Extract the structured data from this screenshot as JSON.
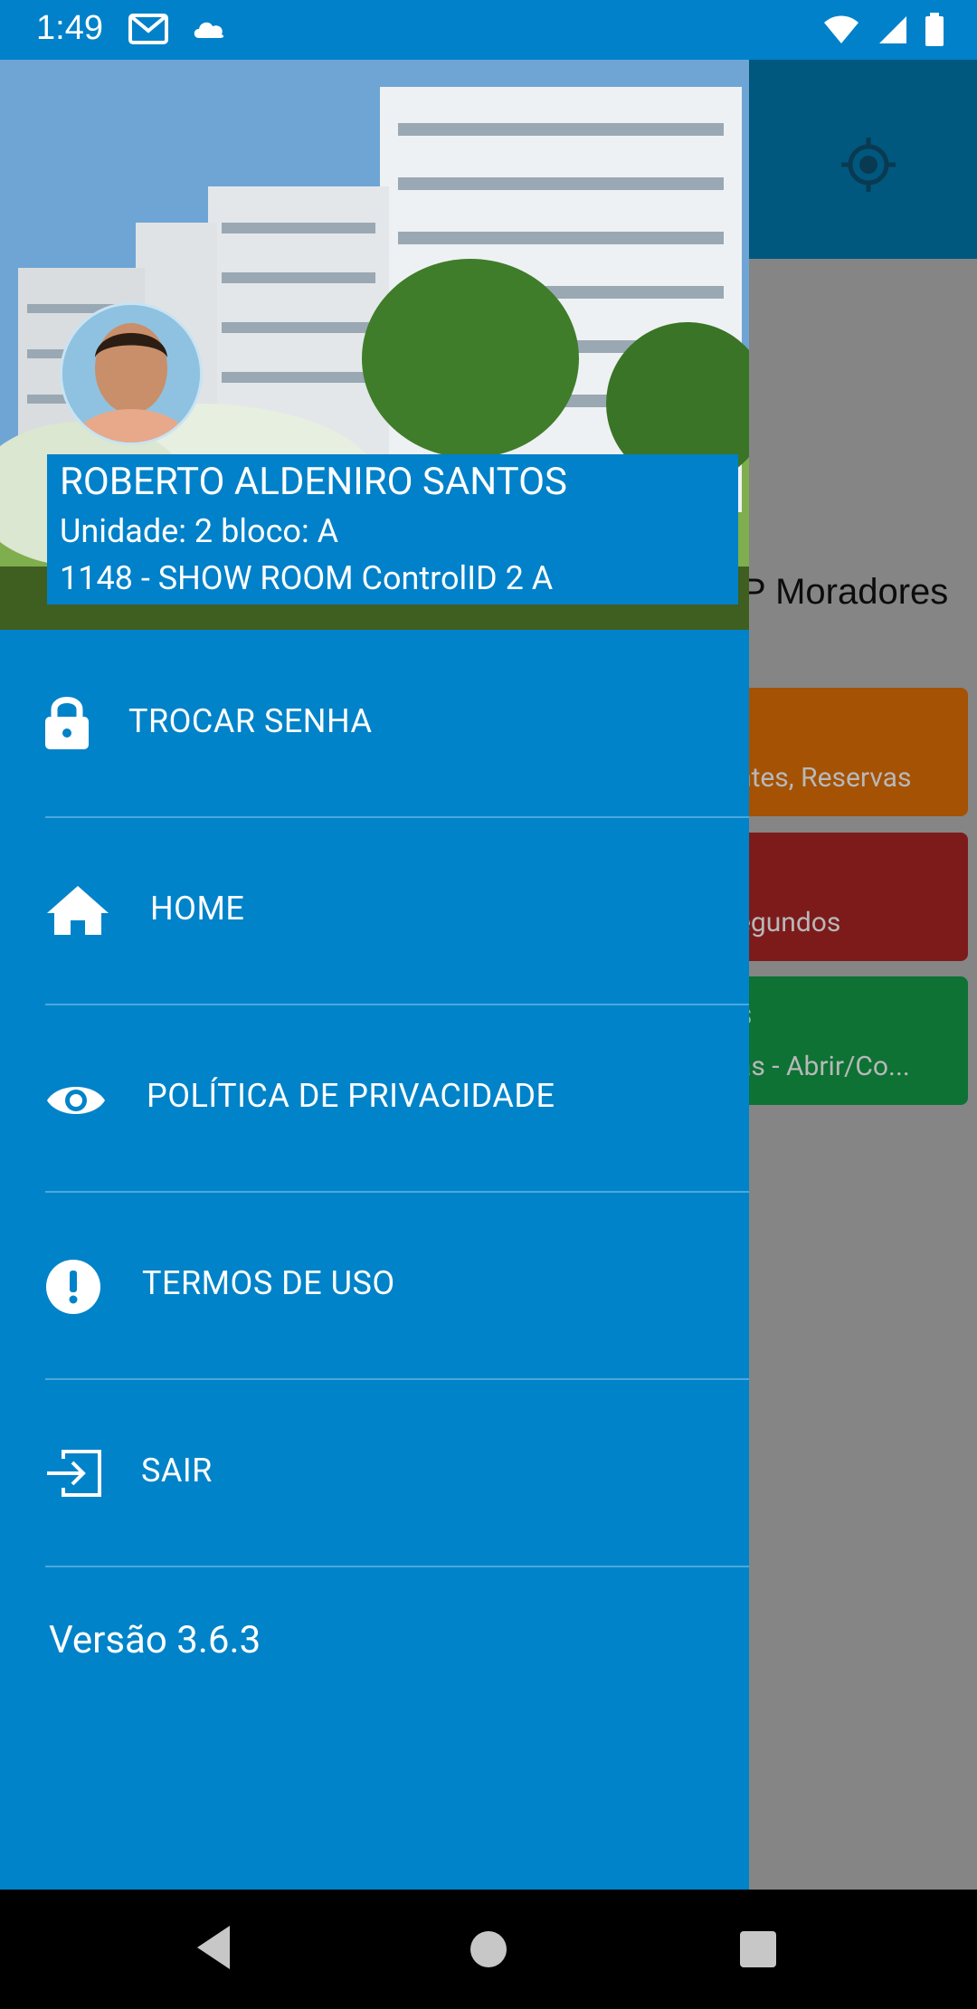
{
  "status_bar": {
    "time": "1:49",
    "left_icons": [
      "gmail-icon",
      "cloud-icon"
    ],
    "right_icons": [
      "wifi-icon",
      "signal-icon",
      "battery-icon"
    ]
  },
  "app": {
    "title_fragment": "P Moradores",
    "cards": [
      {
        "title": "",
        "subtitle": "ntes, Reservas",
        "color": "#a55204"
      },
      {
        "title": "",
        "subtitle": "egundos",
        "color": "#7d1b1b"
      },
      {
        "title": "s",
        "subtitle": "as - Abrir/Co...",
        "color": "#0d7234"
      }
    ]
  },
  "drawer": {
    "header": {
      "name": "ROBERTO ALDENIRO SANTOS",
      "unit": "Unidade: 2 bloco: A",
      "site": "1148 - SHOW ROOM ControlID 2 A"
    },
    "items": [
      {
        "label": "TROCAR SENHA",
        "icon": "lock-icon"
      },
      {
        "label": "HOME",
        "icon": "home-icon"
      },
      {
        "label": "POLÍTICA DE PRIVACIDADE",
        "icon": "eye-icon"
      },
      {
        "label": "TERMOS DE USO",
        "icon": "alert-circle-icon"
      },
      {
        "label": "SAIR",
        "icon": "logout-icon"
      }
    ],
    "version": "Versão 3.6.3"
  },
  "colors": {
    "drawer": "#0083c9",
    "status_bar": "#0081c9",
    "toolbar": "#00587f",
    "scrim": "#858585"
  }
}
